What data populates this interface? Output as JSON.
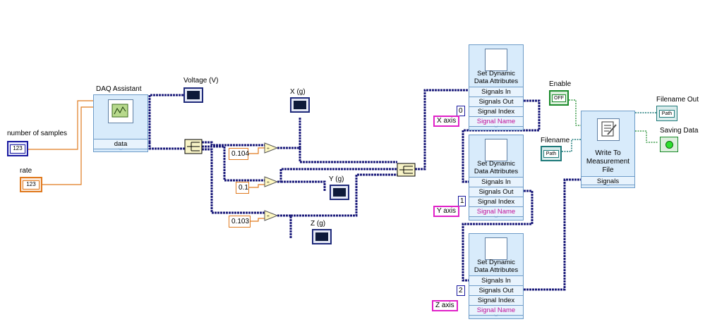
{
  "controls": {
    "number_of_samples": {
      "label": "number of samples",
      "display": "123"
    },
    "rate": {
      "label": "rate",
      "display": "123"
    },
    "enable": {
      "label": "Enable",
      "display": "OFF"
    },
    "filename": {
      "label": "Filename",
      "display": "Path"
    }
  },
  "indicators": {
    "voltage": {
      "label": "Voltage (V)"
    },
    "x_g": {
      "label": "X (g)"
    },
    "y_g": {
      "label": "Y (g)"
    },
    "z_g": {
      "label": "Z (g)"
    },
    "filename_out": {
      "label": "Filename Out",
      "display": "Path"
    },
    "saving_data": {
      "label": "Saving Data"
    }
  },
  "daq_assistant": {
    "label": "DAQ Assistant",
    "terminal": "data"
  },
  "constants": {
    "c1": "0.104",
    "c2": "0.1",
    "c3": "0.103"
  },
  "sdda_nodes": [
    {
      "title_line1": "Set Dynamic",
      "title_line2": "Data Attributes",
      "signals_in": "Signals In",
      "signals_out": "Signals Out",
      "signal_index": "Signal Index",
      "signal_name": "Signal Name",
      "index": "0",
      "name": "X axis"
    },
    {
      "title_line1": "Set Dynamic",
      "title_line2": "Data Attributes",
      "signals_in": "Signals In",
      "signals_out": "Signals Out",
      "signal_index": "Signal Index",
      "signal_name": "Signal Name",
      "index": "1",
      "name": "Y axis"
    },
    {
      "title_line1": "Set Dynamic",
      "title_line2": "Data Attributes",
      "signals_in": "Signals In",
      "signals_out": "Signals Out",
      "signal_index": "Signal Index",
      "signal_name": "Signal Name",
      "index": "2",
      "name": "Z axis"
    }
  ],
  "write_file": {
    "title_line1": "Write To",
    "title_line2": "Measurement",
    "title_line3": "File",
    "terminal": "Signals"
  },
  "colors": {
    "dynamic_wire": "#1a1a7a",
    "numeric_wire": "#e07a1f",
    "bool_wire": "#1a8a2a",
    "path_wire": "#1f7a7a",
    "express_bg": "#d8ebfb"
  }
}
